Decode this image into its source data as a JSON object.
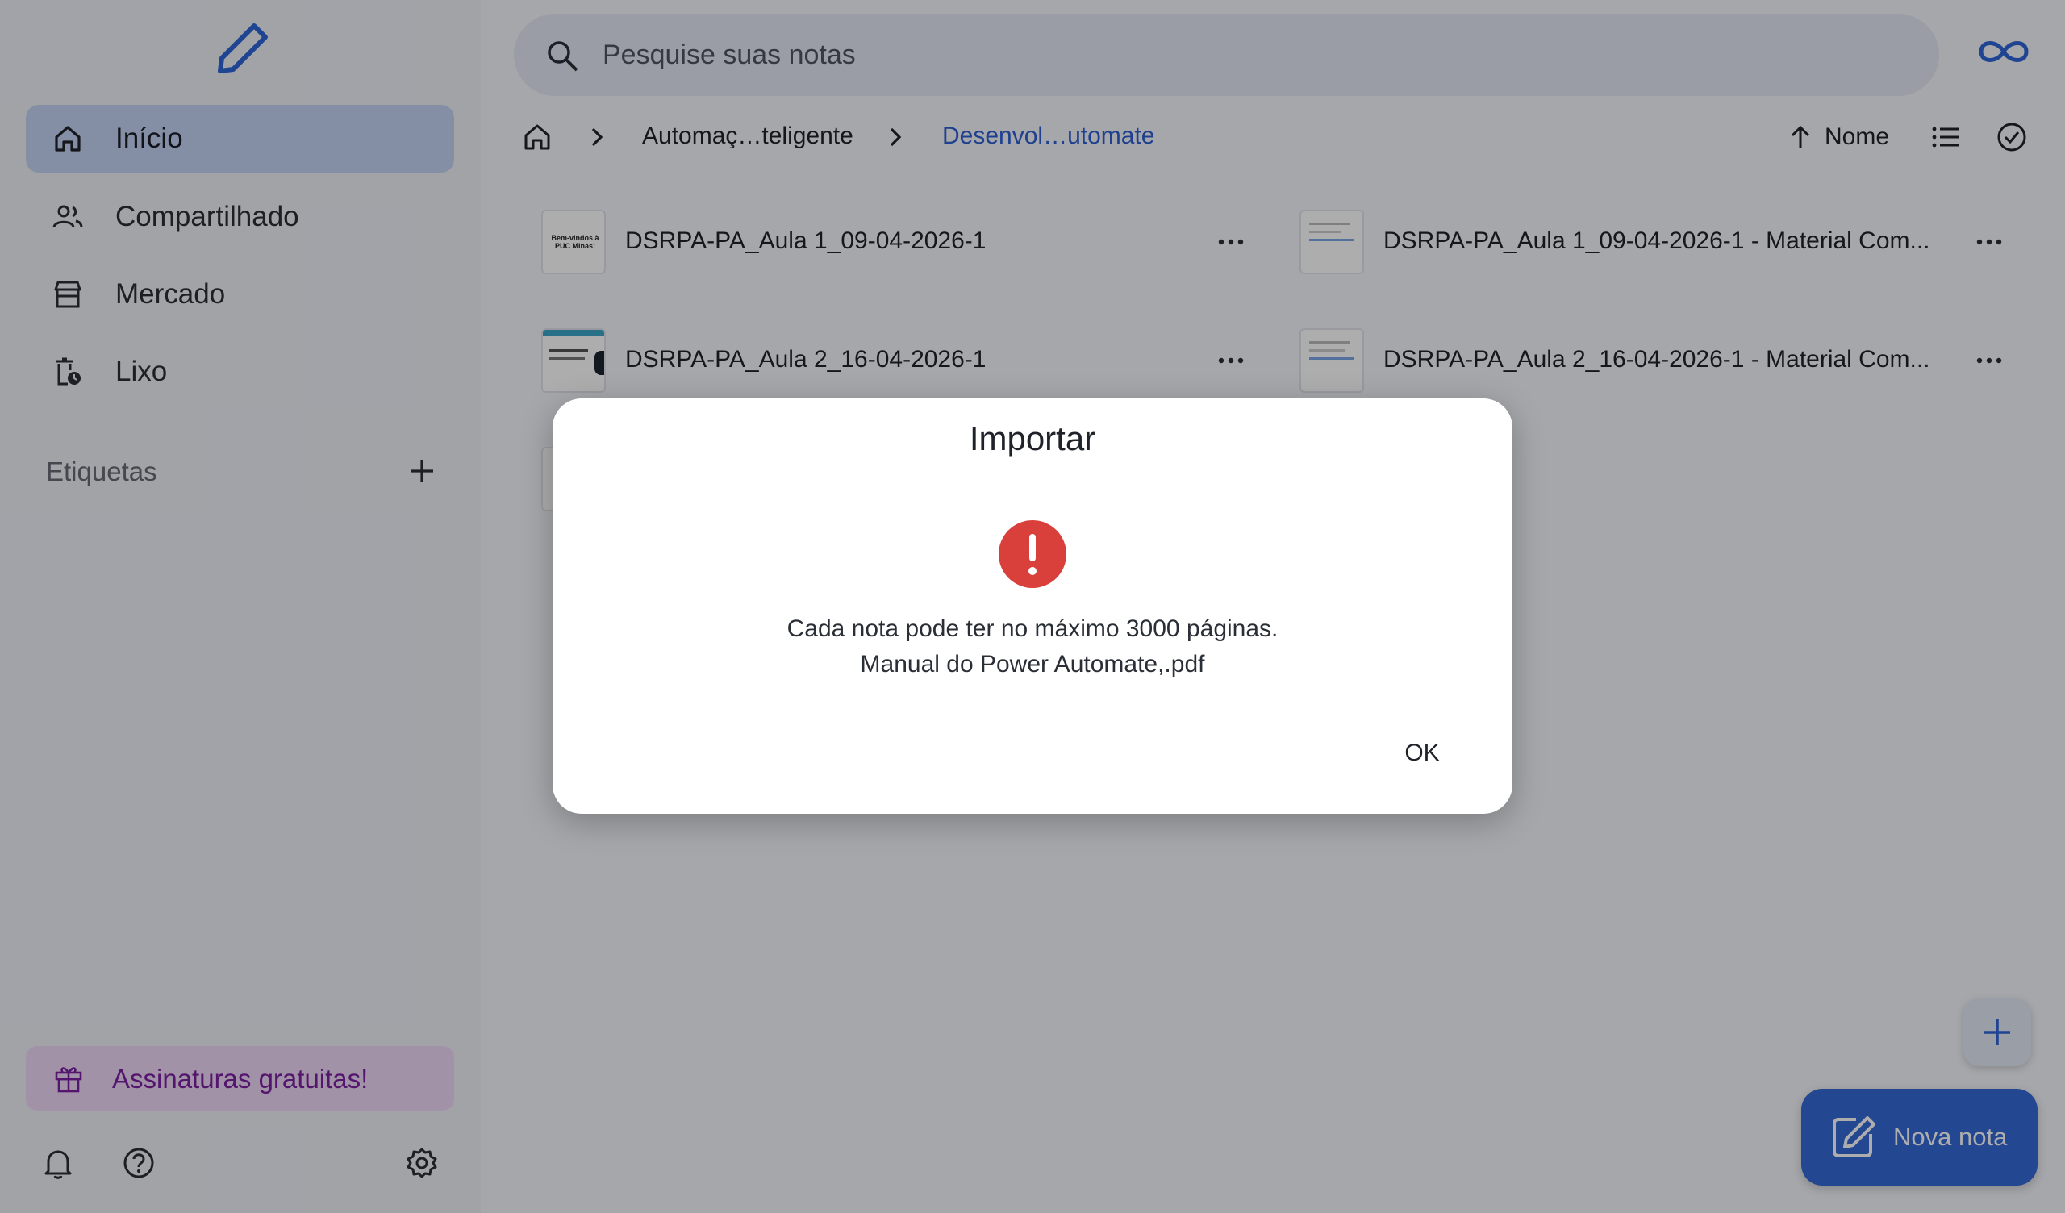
{
  "sidebar": {
    "logo_icon": "pencil-logo-icon",
    "items": [
      {
        "label": "Início",
        "icon": "home-icon",
        "active": true
      },
      {
        "label": "Compartilhado",
        "icon": "people-icon",
        "active": false
      },
      {
        "label": "Mercado",
        "icon": "store-icon",
        "active": false
      },
      {
        "label": "Lixo",
        "icon": "trash-clock-icon",
        "active": false
      }
    ],
    "tags_label": "Etiquetas",
    "promo_label": "Assinaturas gratuitas!"
  },
  "search": {
    "placeholder": "Pesquise suas notas"
  },
  "breadcrumb": {
    "items": [
      {
        "label": "Automaç…teligente"
      },
      {
        "label": "Desenvol…utomate"
      }
    ]
  },
  "sort": {
    "label": "Nome"
  },
  "notes": [
    {
      "title": "DSRPA-PA_Aula 1_09-04-2026-1"
    },
    {
      "title": "DSRPA-PA_Aula 1_09-04-2026-1 - Material Com..."
    },
    {
      "title": "DSRPA-PA_Aula 2_16-04-2026-1"
    },
    {
      "title": "DSRPA-PA_Aula 2_16-04-2026-1 - Material Com..."
    }
  ],
  "thumb_text": "Bem-vindos à PUC Minas!",
  "fab": {
    "new_note_label": "Nova nota"
  },
  "dialog": {
    "title": "Importar",
    "message_line1": "Cada nota pode ter no máximo 3000 páginas.",
    "message_line2": "Manual do Power Automate,.pdf",
    "ok_label": "OK"
  },
  "colors": {
    "accent": "#3569d8",
    "error": "#d93f3b",
    "promo_text": "#7b1fa2"
  }
}
